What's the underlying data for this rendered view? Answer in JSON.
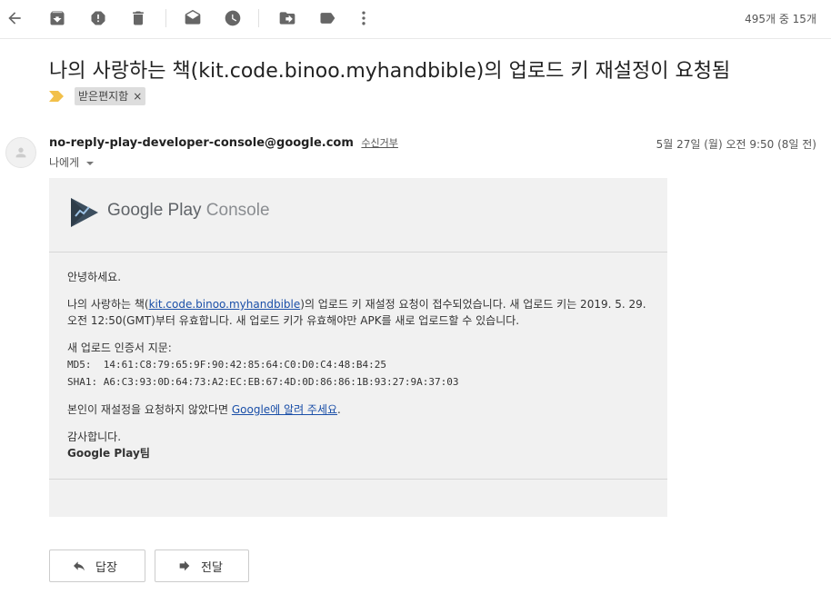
{
  "toolbar": {
    "items": [
      {
        "name": "back-icon"
      },
      {
        "name": "archive-icon"
      },
      {
        "name": "report-spam-icon"
      },
      {
        "name": "delete-icon"
      },
      {
        "name": "mark-unread-icon"
      },
      {
        "name": "snooze-icon"
      },
      {
        "name": "move-to-icon"
      },
      {
        "name": "label-icon"
      },
      {
        "name": "more-icon"
      }
    ],
    "pager": "495개 중 15개"
  },
  "subject": "나의 사랑하는 책(kit.code.binoo.myhandbible)의 업로드 키 재설정이 요청됨",
  "label_chip": "받은편지함",
  "label_close": "×",
  "sender": {
    "email": "no-reply-play-developer-console@google.com",
    "unsubscribe": "수신거부",
    "to": "나에게",
    "date": "5월 27일 (월) 오전 9:50 (8일 전)"
  },
  "email_body": {
    "brand_google_play": "Google Play",
    "brand_console": "Console",
    "greeting": "안녕하세요.",
    "p1_before": "나의 사랑하는 책(",
    "p1_link": "kit.code.binoo.myhandbible",
    "p1_after": ")의 업로드 키 재설정 요청이 접수되었습니다. 새 업로드 키는 2019. 5. 29. 오전 12:50(GMT)부터 유효합니다. 새 업로드 키가 유효해야만 APK를 새로 업로드할 수 있습니다.",
    "fingerprint_title": "새 업로드 인증서 지문:",
    "md5": "MD5:  14:61:C8:79:65:9F:90:42:85:64:C0:D0:C4:48:B4:25",
    "sha1": "SHA1: A6:C3:93:0D:64:73:A2:EC:EB:67:4D:0D:86:86:1B:93:27:9A:37:03",
    "p3_before": "본인이 재설정을 요청하지 않았다면 ",
    "p3_link": "Google에 알려 주세요",
    "p3_after": ".",
    "thanks": "감사합니다.",
    "signature": "Google Play팀"
  },
  "actions": {
    "reply": "답장",
    "forward": "전달"
  }
}
